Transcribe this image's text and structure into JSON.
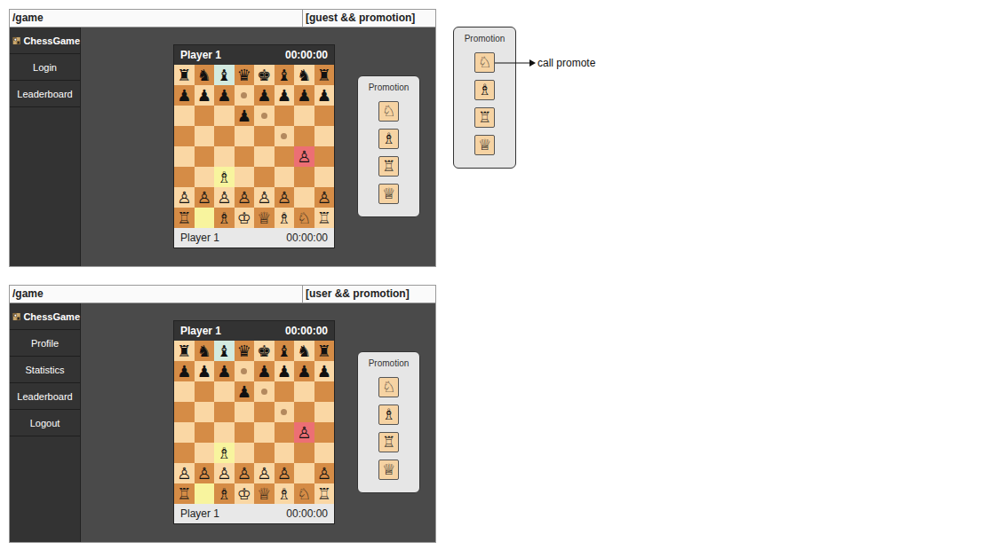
{
  "frames": [
    {
      "path": "/game",
      "condition": "[guest && promotion]",
      "logo": "ChessGame",
      "sidebar": {
        "items": [
          {
            "label": "Login"
          },
          {
            "label": "Leaderboard"
          }
        ]
      },
      "board": {
        "top": {
          "player": "Player 1",
          "time": "00:00:00"
        },
        "bottom": {
          "player": "Player 1",
          "time": "00:00:00"
        },
        "rows": [
          [
            {
              "piece": "♜",
              "hint": false,
              "color": null
            },
            {
              "piece": "♞",
              "hint": false,
              "color": null
            },
            {
              "piece": "♝",
              "hint": false,
              "color": "#d3eadf"
            },
            {
              "piece": "♛",
              "hint": false,
              "color": null
            },
            {
              "piece": "♚",
              "hint": false,
              "color": null
            },
            {
              "piece": "♝",
              "hint": false,
              "color": null
            },
            {
              "piece": "♞",
              "hint": false,
              "color": null
            },
            {
              "piece": "♜",
              "hint": false,
              "color": null
            }
          ],
          [
            {
              "piece": "♟",
              "hint": false,
              "color": null
            },
            {
              "piece": "♟",
              "hint": false,
              "color": null
            },
            {
              "piece": "♟",
              "hint": false,
              "color": null
            },
            {
              "piece": "",
              "hint": true,
              "color": null
            },
            {
              "piece": "♟",
              "hint": false,
              "color": null
            },
            {
              "piece": "♟",
              "hint": false,
              "color": null
            },
            {
              "piece": "♟",
              "hint": false,
              "color": null
            },
            {
              "piece": "♟",
              "hint": false,
              "color": null
            }
          ],
          [
            {
              "piece": "",
              "hint": false,
              "color": null
            },
            {
              "piece": "",
              "hint": false,
              "color": null
            },
            {
              "piece": "",
              "hint": false,
              "color": null
            },
            {
              "piece": "♟",
              "hint": false,
              "color": null
            },
            {
              "piece": "",
              "hint": true,
              "color": null
            },
            {
              "piece": "",
              "hint": false,
              "color": null
            },
            {
              "piece": "",
              "hint": false,
              "color": null
            },
            {
              "piece": "",
              "hint": false,
              "color": null
            }
          ],
          [
            {
              "piece": "",
              "hint": false,
              "color": null
            },
            {
              "piece": "",
              "hint": false,
              "color": null
            },
            {
              "piece": "",
              "hint": false,
              "color": null
            },
            {
              "piece": "",
              "hint": false,
              "color": null
            },
            {
              "piece": "",
              "hint": false,
              "color": null
            },
            {
              "piece": "",
              "hint": true,
              "color": null
            },
            {
              "piece": "",
              "hint": false,
              "color": null
            },
            {
              "piece": "",
              "hint": false,
              "color": null
            }
          ],
          [
            {
              "piece": "",
              "hint": false,
              "color": null
            },
            {
              "piece": "",
              "hint": false,
              "color": null
            },
            {
              "piece": "",
              "hint": false,
              "color": null
            },
            {
              "piece": "",
              "hint": false,
              "color": null
            },
            {
              "piece": "",
              "hint": false,
              "color": null
            },
            {
              "piece": "",
              "hint": false,
              "color": null
            },
            {
              "piece": "♙",
              "hint": false,
              "color": "#ec6f74"
            },
            {
              "piece": "",
              "hint": false,
              "color": null
            }
          ],
          [
            {
              "piece": "",
              "hint": false,
              "color": null
            },
            {
              "piece": "",
              "hint": false,
              "color": null
            },
            {
              "piece": "♗",
              "hint": false,
              "color": "#f8f49e"
            },
            {
              "piece": "",
              "hint": false,
              "color": null
            },
            {
              "piece": "",
              "hint": false,
              "color": null
            },
            {
              "piece": "",
              "hint": false,
              "color": null
            },
            {
              "piece": "",
              "hint": false,
              "color": null
            },
            {
              "piece": "",
              "hint": false,
              "color": null
            }
          ],
          [
            {
              "piece": "♙",
              "hint": false,
              "color": null
            },
            {
              "piece": "♙",
              "hint": false,
              "color": null
            },
            {
              "piece": "♙",
              "hint": false,
              "color": null
            },
            {
              "piece": "♙",
              "hint": false,
              "color": null
            },
            {
              "piece": "♙",
              "hint": false,
              "color": null
            },
            {
              "piece": "♙",
              "hint": false,
              "color": null
            },
            {
              "piece": "",
              "hint": false,
              "color": null
            },
            {
              "piece": "♙",
              "hint": false,
              "color": null
            }
          ],
          [
            {
              "piece": "♖",
              "hint": false,
              "color": null
            },
            {
              "piece": "",
              "hint": false,
              "color": "#f8f49e"
            },
            {
              "piece": "♗",
              "hint": false,
              "color": null
            },
            {
              "piece": "♔",
              "hint": false,
              "color": null
            },
            {
              "piece": "♕",
              "hint": false,
              "color": null
            },
            {
              "piece": "♗",
              "hint": false,
              "color": null
            },
            {
              "piece": "♘",
              "hint": false,
              "color": null
            },
            {
              "piece": "♖",
              "hint": false,
              "color": null
            }
          ]
        ]
      },
      "promotion": {
        "title": "Promotion",
        "options": [
          "♘",
          "♗",
          "♖",
          "♕"
        ]
      }
    },
    {
      "path": "/game",
      "condition": "[user && promotion]",
      "logo": "ChessGame",
      "sidebar": {
        "items": [
          {
            "label": "Profile"
          },
          {
            "label": "Statistics"
          },
          {
            "label": "Leaderboard"
          },
          {
            "label": "Logout"
          }
        ]
      },
      "board": {
        "top": {
          "player": "Player 1",
          "time": "00:00:00"
        },
        "bottom": {
          "player": "Player 1",
          "time": "00:00:00"
        },
        "rows": [
          [
            {
              "piece": "♜",
              "hint": false,
              "color": null
            },
            {
              "piece": "♞",
              "hint": false,
              "color": null
            },
            {
              "piece": "♝",
              "hint": false,
              "color": "#d3eadf"
            },
            {
              "piece": "♛",
              "hint": false,
              "color": null
            },
            {
              "piece": "♚",
              "hint": false,
              "color": null
            },
            {
              "piece": "♝",
              "hint": false,
              "color": null
            },
            {
              "piece": "♞",
              "hint": false,
              "color": null
            },
            {
              "piece": "♜",
              "hint": false,
              "color": null
            }
          ],
          [
            {
              "piece": "♟",
              "hint": false,
              "color": null
            },
            {
              "piece": "♟",
              "hint": false,
              "color": null
            },
            {
              "piece": "♟",
              "hint": false,
              "color": null
            },
            {
              "piece": "",
              "hint": true,
              "color": null
            },
            {
              "piece": "♟",
              "hint": false,
              "color": null
            },
            {
              "piece": "♟",
              "hint": false,
              "color": null
            },
            {
              "piece": "♟",
              "hint": false,
              "color": null
            },
            {
              "piece": "♟",
              "hint": false,
              "color": null
            }
          ],
          [
            {
              "piece": "",
              "hint": false,
              "color": null
            },
            {
              "piece": "",
              "hint": false,
              "color": null
            },
            {
              "piece": "",
              "hint": false,
              "color": null
            },
            {
              "piece": "♟",
              "hint": false,
              "color": null
            },
            {
              "piece": "",
              "hint": true,
              "color": null
            },
            {
              "piece": "",
              "hint": false,
              "color": null
            },
            {
              "piece": "",
              "hint": false,
              "color": null
            },
            {
              "piece": "",
              "hint": false,
              "color": null
            }
          ],
          [
            {
              "piece": "",
              "hint": false,
              "color": null
            },
            {
              "piece": "",
              "hint": false,
              "color": null
            },
            {
              "piece": "",
              "hint": false,
              "color": null
            },
            {
              "piece": "",
              "hint": false,
              "color": null
            },
            {
              "piece": "",
              "hint": false,
              "color": null
            },
            {
              "piece": "",
              "hint": true,
              "color": null
            },
            {
              "piece": "",
              "hint": false,
              "color": null
            },
            {
              "piece": "",
              "hint": false,
              "color": null
            }
          ],
          [
            {
              "piece": "",
              "hint": false,
              "color": null
            },
            {
              "piece": "",
              "hint": false,
              "color": null
            },
            {
              "piece": "",
              "hint": false,
              "color": null
            },
            {
              "piece": "",
              "hint": false,
              "color": null
            },
            {
              "piece": "",
              "hint": false,
              "color": null
            },
            {
              "piece": "",
              "hint": false,
              "color": null
            },
            {
              "piece": "♙",
              "hint": false,
              "color": "#ec6f74"
            },
            {
              "piece": "",
              "hint": false,
              "color": null
            }
          ],
          [
            {
              "piece": "",
              "hint": false,
              "color": null
            },
            {
              "piece": "",
              "hint": false,
              "color": null
            },
            {
              "piece": "♗",
              "hint": false,
              "color": "#f8f49e"
            },
            {
              "piece": "",
              "hint": false,
              "color": null
            },
            {
              "piece": "",
              "hint": false,
              "color": null
            },
            {
              "piece": "",
              "hint": false,
              "color": null
            },
            {
              "piece": "",
              "hint": false,
              "color": null
            },
            {
              "piece": "",
              "hint": false,
              "color": null
            }
          ],
          [
            {
              "piece": "♙",
              "hint": false,
              "color": null
            },
            {
              "piece": "♙",
              "hint": false,
              "color": null
            },
            {
              "piece": "♙",
              "hint": false,
              "color": null
            },
            {
              "piece": "♙",
              "hint": false,
              "color": null
            },
            {
              "piece": "♙",
              "hint": false,
              "color": null
            },
            {
              "piece": "♙",
              "hint": false,
              "color": null
            },
            {
              "piece": "",
              "hint": false,
              "color": null
            },
            {
              "piece": "♙",
              "hint": false,
              "color": null
            }
          ],
          [
            {
              "piece": "♖",
              "hint": false,
              "color": null
            },
            {
              "piece": "",
              "hint": false,
              "color": "#f8f49e"
            },
            {
              "piece": "♗",
              "hint": false,
              "color": null
            },
            {
              "piece": "♔",
              "hint": false,
              "color": null
            },
            {
              "piece": "♕",
              "hint": false,
              "color": null
            },
            {
              "piece": "♗",
              "hint": false,
              "color": null
            },
            {
              "piece": "♘",
              "hint": false,
              "color": null
            },
            {
              "piece": "♖",
              "hint": false,
              "color": null
            }
          ]
        ]
      },
      "promotion": {
        "title": "Promotion",
        "options": [
          "♘",
          "♗",
          "♖",
          "♕"
        ]
      }
    }
  ],
  "annotation": {
    "promotion": {
      "title": "Promotion",
      "options": [
        "♘",
        "♗",
        "♖",
        "♕"
      ]
    },
    "callout": "call promote"
  }
}
